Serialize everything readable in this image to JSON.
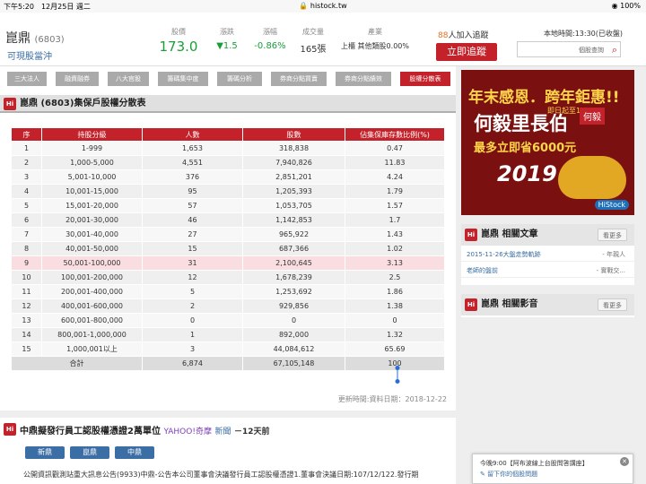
{
  "status_bar": {
    "time_date": "下午5:20　12月25日 週二",
    "url": "histock.tw",
    "battery": "100%"
  },
  "stock": {
    "name": "崑鼎",
    "code": "(6803)",
    "subtitle": "可現股當沖",
    "quotes": [
      {
        "label": "股價",
        "value": "173.0"
      },
      {
        "label": "漲跌",
        "value": "▼1.5"
      },
      {
        "label": "漲幅",
        "value": "-0.86%"
      },
      {
        "label": "成交量",
        "value": "165張"
      },
      {
        "label": "產業",
        "value": "上櫃 其他類股0.00%"
      }
    ],
    "tracking_count": "88",
    "tracking_suffix": "人加入追蹤",
    "track_button": "立即追蹤",
    "update_time": "本地時間:13:30(已收盤)",
    "search_placeholder": "個股查詢"
  },
  "tabs": [
    "三大法人",
    "融資融券",
    "八大官股",
    "籌碼集中度",
    "籌碼分析",
    "券商分點買賣",
    "券商分點績效",
    "股權分散表"
  ],
  "panel": {
    "title": "崑鼎 (6803)集保戶股權分散表",
    "logo": "Hi"
  },
  "table": {
    "headers": [
      "序",
      "持股分級",
      "人數",
      "股數",
      "佔集保庫存數比例(%)"
    ],
    "rows": [
      [
        "1",
        "1-999",
        "1,653",
        "318,838",
        "0.47"
      ],
      [
        "2",
        "1,000-5,000",
        "4,551",
        "7,940,826",
        "11.83"
      ],
      [
        "3",
        "5,001-10,000",
        "376",
        "2,851,201",
        "4.24"
      ],
      [
        "4",
        "10,001-15,000",
        "95",
        "1,205,393",
        "1.79"
      ],
      [
        "5",
        "15,001-20,000",
        "57",
        "1,053,705",
        "1.57"
      ],
      [
        "6",
        "20,001-30,000",
        "46",
        "1,142,853",
        "1.7"
      ],
      [
        "7",
        "30,001-40,000",
        "27",
        "965,922",
        "1.43"
      ],
      [
        "8",
        "40,001-50,000",
        "15",
        "687,366",
        "1.02"
      ],
      [
        "9",
        "50,001-100,000",
        "31",
        "2,100,645",
        "3.13"
      ],
      [
        "10",
        "100,001-200,000",
        "12",
        "1,678,239",
        "2.5"
      ],
      [
        "11",
        "200,001-400,000",
        "5",
        "1,253,692",
        "1.86"
      ],
      [
        "12",
        "400,001-600,000",
        "2",
        "929,856",
        "1.38"
      ],
      [
        "13",
        "600,001-800,000",
        "0",
        "0",
        "0"
      ],
      [
        "14",
        "800,001-1,000,000",
        "1",
        "892,000",
        "1.32"
      ],
      [
        "15",
        "1,000,001以上",
        "3",
        "44,084,612",
        "65.69"
      ]
    ],
    "total": [
      "合計",
      "6,874",
      "67,105,148",
      "100"
    ],
    "update": "更新時間:資料日期：2018-12-22"
  },
  "news": {
    "title": "中鼎擬發行員工認股權憑證2萬單位",
    "source": "YAHOO!奇摩",
    "source2": "新聞",
    "ago": "－12天前",
    "tags": [
      "新鼎",
      "崑鼎",
      "中鼎"
    ],
    "text": "公開資訊觀測站重大訊息公告(9933)中鼎-公告本公司董事會決議發行員工認股權憑證1.董事會決議日期:107/12/122.發行期"
  },
  "ad": {
    "line1": "年末感恩．跨年鉅惠!!",
    "line2": "何毅里長伯",
    "line3": "最多立即省6000元",
    "line4": "2019",
    "badge": "何毅",
    "date": "即日起至1/6",
    "brand": "HiStock"
  },
  "related": {
    "title": "崑鼎 相關文章",
    "more": "看更多",
    "items": [
      {
        "title": "2015-11-26大盤走勢軌跡",
        "author": "- 年親人"
      },
      {
        "title": "老師的盤前",
        "author": "- 實戰交..."
      }
    ]
  },
  "videos": {
    "title": "崑鼎 相關影音",
    "more": "看更多"
  },
  "popup": {
    "line1": "今晚9:00【阿布波線上台股問答講座】",
    "line2": "留下你的個股問題"
  }
}
